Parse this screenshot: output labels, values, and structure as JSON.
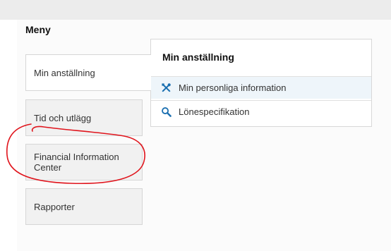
{
  "menu": {
    "title": "Meny",
    "items": [
      {
        "label": "Min anställning",
        "active": true
      },
      {
        "label": "Tid och utlägg",
        "active": false
      },
      {
        "label": "Financial Information Center",
        "active": false
      },
      {
        "label": "Rapporter",
        "active": false
      }
    ]
  },
  "submenu": {
    "title": "Min anställning",
    "items": [
      {
        "label": "Min personliga information",
        "icon": "tools-icon",
        "selected": true
      },
      {
        "label": "Lönespecifikation",
        "icon": "search-icon",
        "selected": false
      }
    ]
  },
  "colors": {
    "icon_blue": "#1a6fb0",
    "annotation_red": "#e0141c",
    "selected_bg": "#eef5fa"
  }
}
